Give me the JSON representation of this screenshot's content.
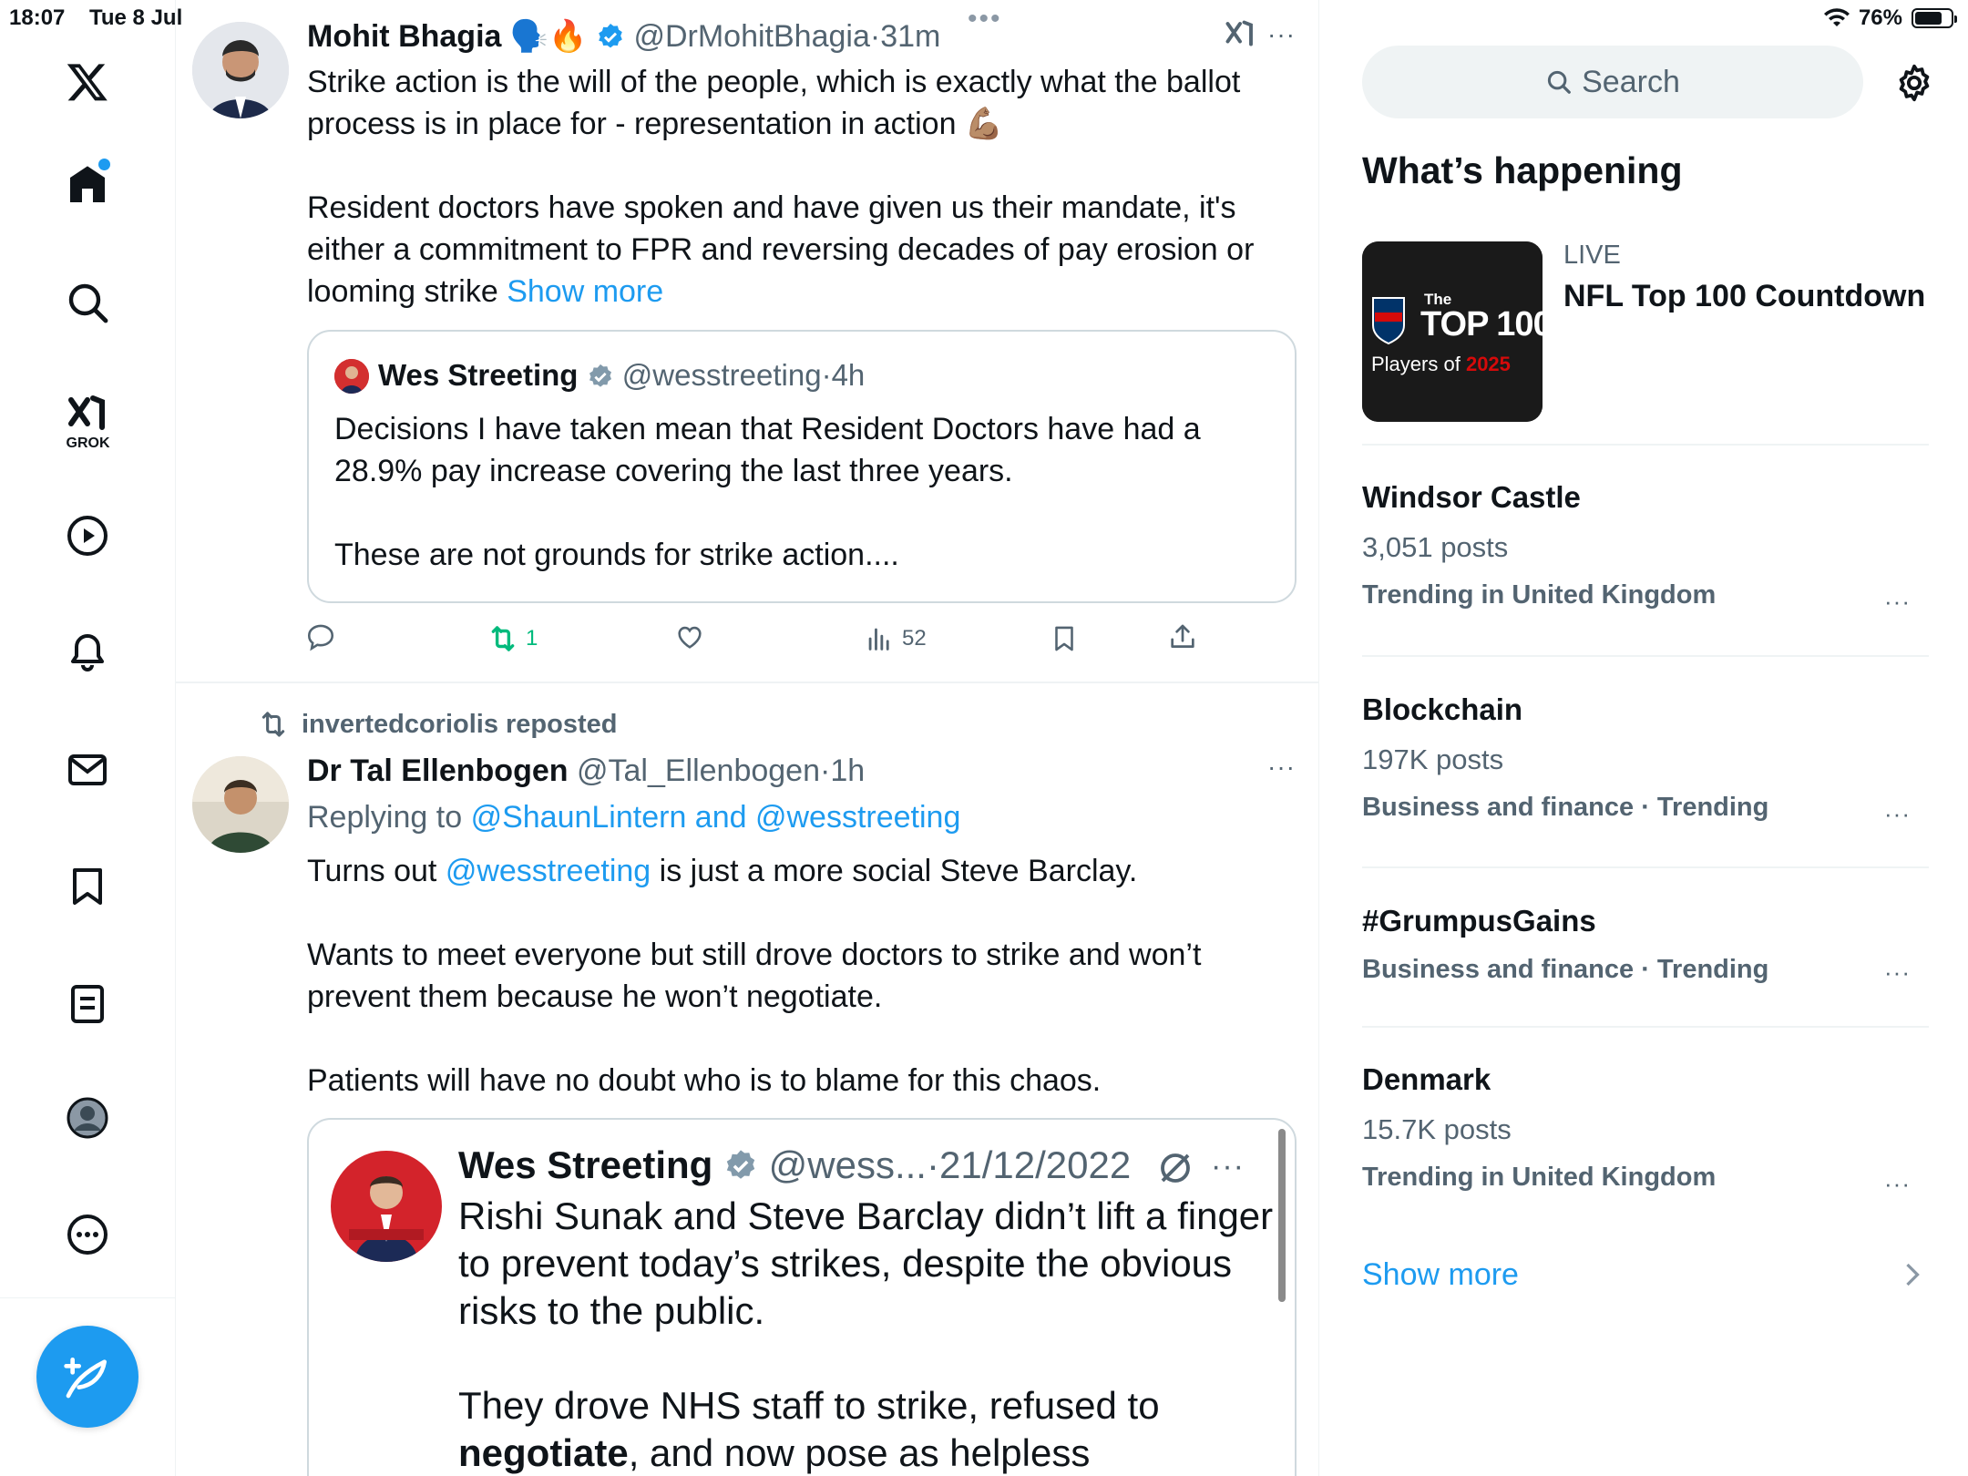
{
  "status_bar": {
    "time": "18:07",
    "date": "Tue 8 Jul",
    "battery": "76%"
  },
  "sidebar": {
    "grok_label": "GROK",
    "icons": [
      "x-logo-icon",
      "home-icon",
      "search-icon",
      "grok-icon",
      "video-icon",
      "notifications-icon",
      "messages-icon",
      "bookmarks-icon",
      "lists-icon",
      "profile-icon",
      "more-icon"
    ]
  },
  "tweet1": {
    "name": "Mohit Bhagia",
    "emojis": "🗣️🔥",
    "handle": "@DrMohitBhagia",
    "dot": "·",
    "time": "31m",
    "line1": "Strike action is the will of the people, which is exactly what the ballot",
    "line2": "process is in place for - representation in action 💪🏽",
    "line3": "Resident doctors have spoken and have given us their mandate, it's",
    "line4": "either a commitment to FPR and reversing decades of pay erosion or",
    "line5": "looming strike",
    "show_more": "Show more",
    "quote": {
      "name": "Wes Streeting",
      "handle": "@wesstreeting",
      "dot": "·",
      "time": "4h",
      "line1": "Decisions I have taken mean that Resident Doctors have had a",
      "line2": "28.9% pay increase covering the last three years.",
      "line3": "These are not grounds for strike action...."
    },
    "retweets": "1",
    "views": "52"
  },
  "tweet2": {
    "reposted_by": "invertedcoriolis reposted",
    "name": "Dr Tal Ellenbogen",
    "handle": "@Tal_Ellenbogen",
    "dot": "·",
    "time": "1h",
    "replying_prefix": "Replying to",
    "replying_to": "@ShaunLintern and @wesstreeting",
    "line1_a": "Turns out",
    "line1_mention": "@wesstreeting",
    "line1_b": "is just a more social Steve Barclay.",
    "line2": "Wants to meet everyone but still drove doctors to strike and won’t",
    "line3": "prevent them because he won’t negotiate.",
    "line4": "Patients will have no doubt who is to blame for this chaos.",
    "quote": {
      "name": "Wes Streeting",
      "handle": "@wess...",
      "dot": "·",
      "date": "21/12/2022",
      "line1": "Rishi Sunak and Steve Barclay didn’t lift a finger",
      "line2": "to prevent today’s strikes, despite the obvious",
      "line3": "risks to the public.",
      "line4": "They drove NHS staff to strike, refused to",
      "line5_bold": "negotiate",
      "line5_rest": ", and now pose as helpless"
    }
  },
  "right": {
    "search_placeholder": "Search",
    "heading": "What’s happening",
    "featured": {
      "label": "LIVE",
      "title": "NFL Top 100 Countdown",
      "thumb_top": "The",
      "thumb_main": "TOP 100",
      "thumb_sub": "Players of",
      "thumb_year": "2025"
    },
    "trends": [
      {
        "title": "Windsor Castle",
        "posts": "3,051 posts",
        "meta": "Trending in United Kingdom"
      },
      {
        "title": "Blockchain",
        "posts": "197K posts",
        "meta": "Business and finance · Trending"
      },
      {
        "title": "#GrumpusGains",
        "posts": "",
        "meta": "Business and finance · Trending"
      },
      {
        "title": "Denmark",
        "posts": "15.7K posts",
        "meta": "Trending in United Kingdom"
      }
    ],
    "show_more": "Show more"
  },
  "colors": {
    "accent": "#1d9bf0",
    "retweet_green": "#00ba7c",
    "muted": "#536471",
    "border": "#cfd9de"
  }
}
